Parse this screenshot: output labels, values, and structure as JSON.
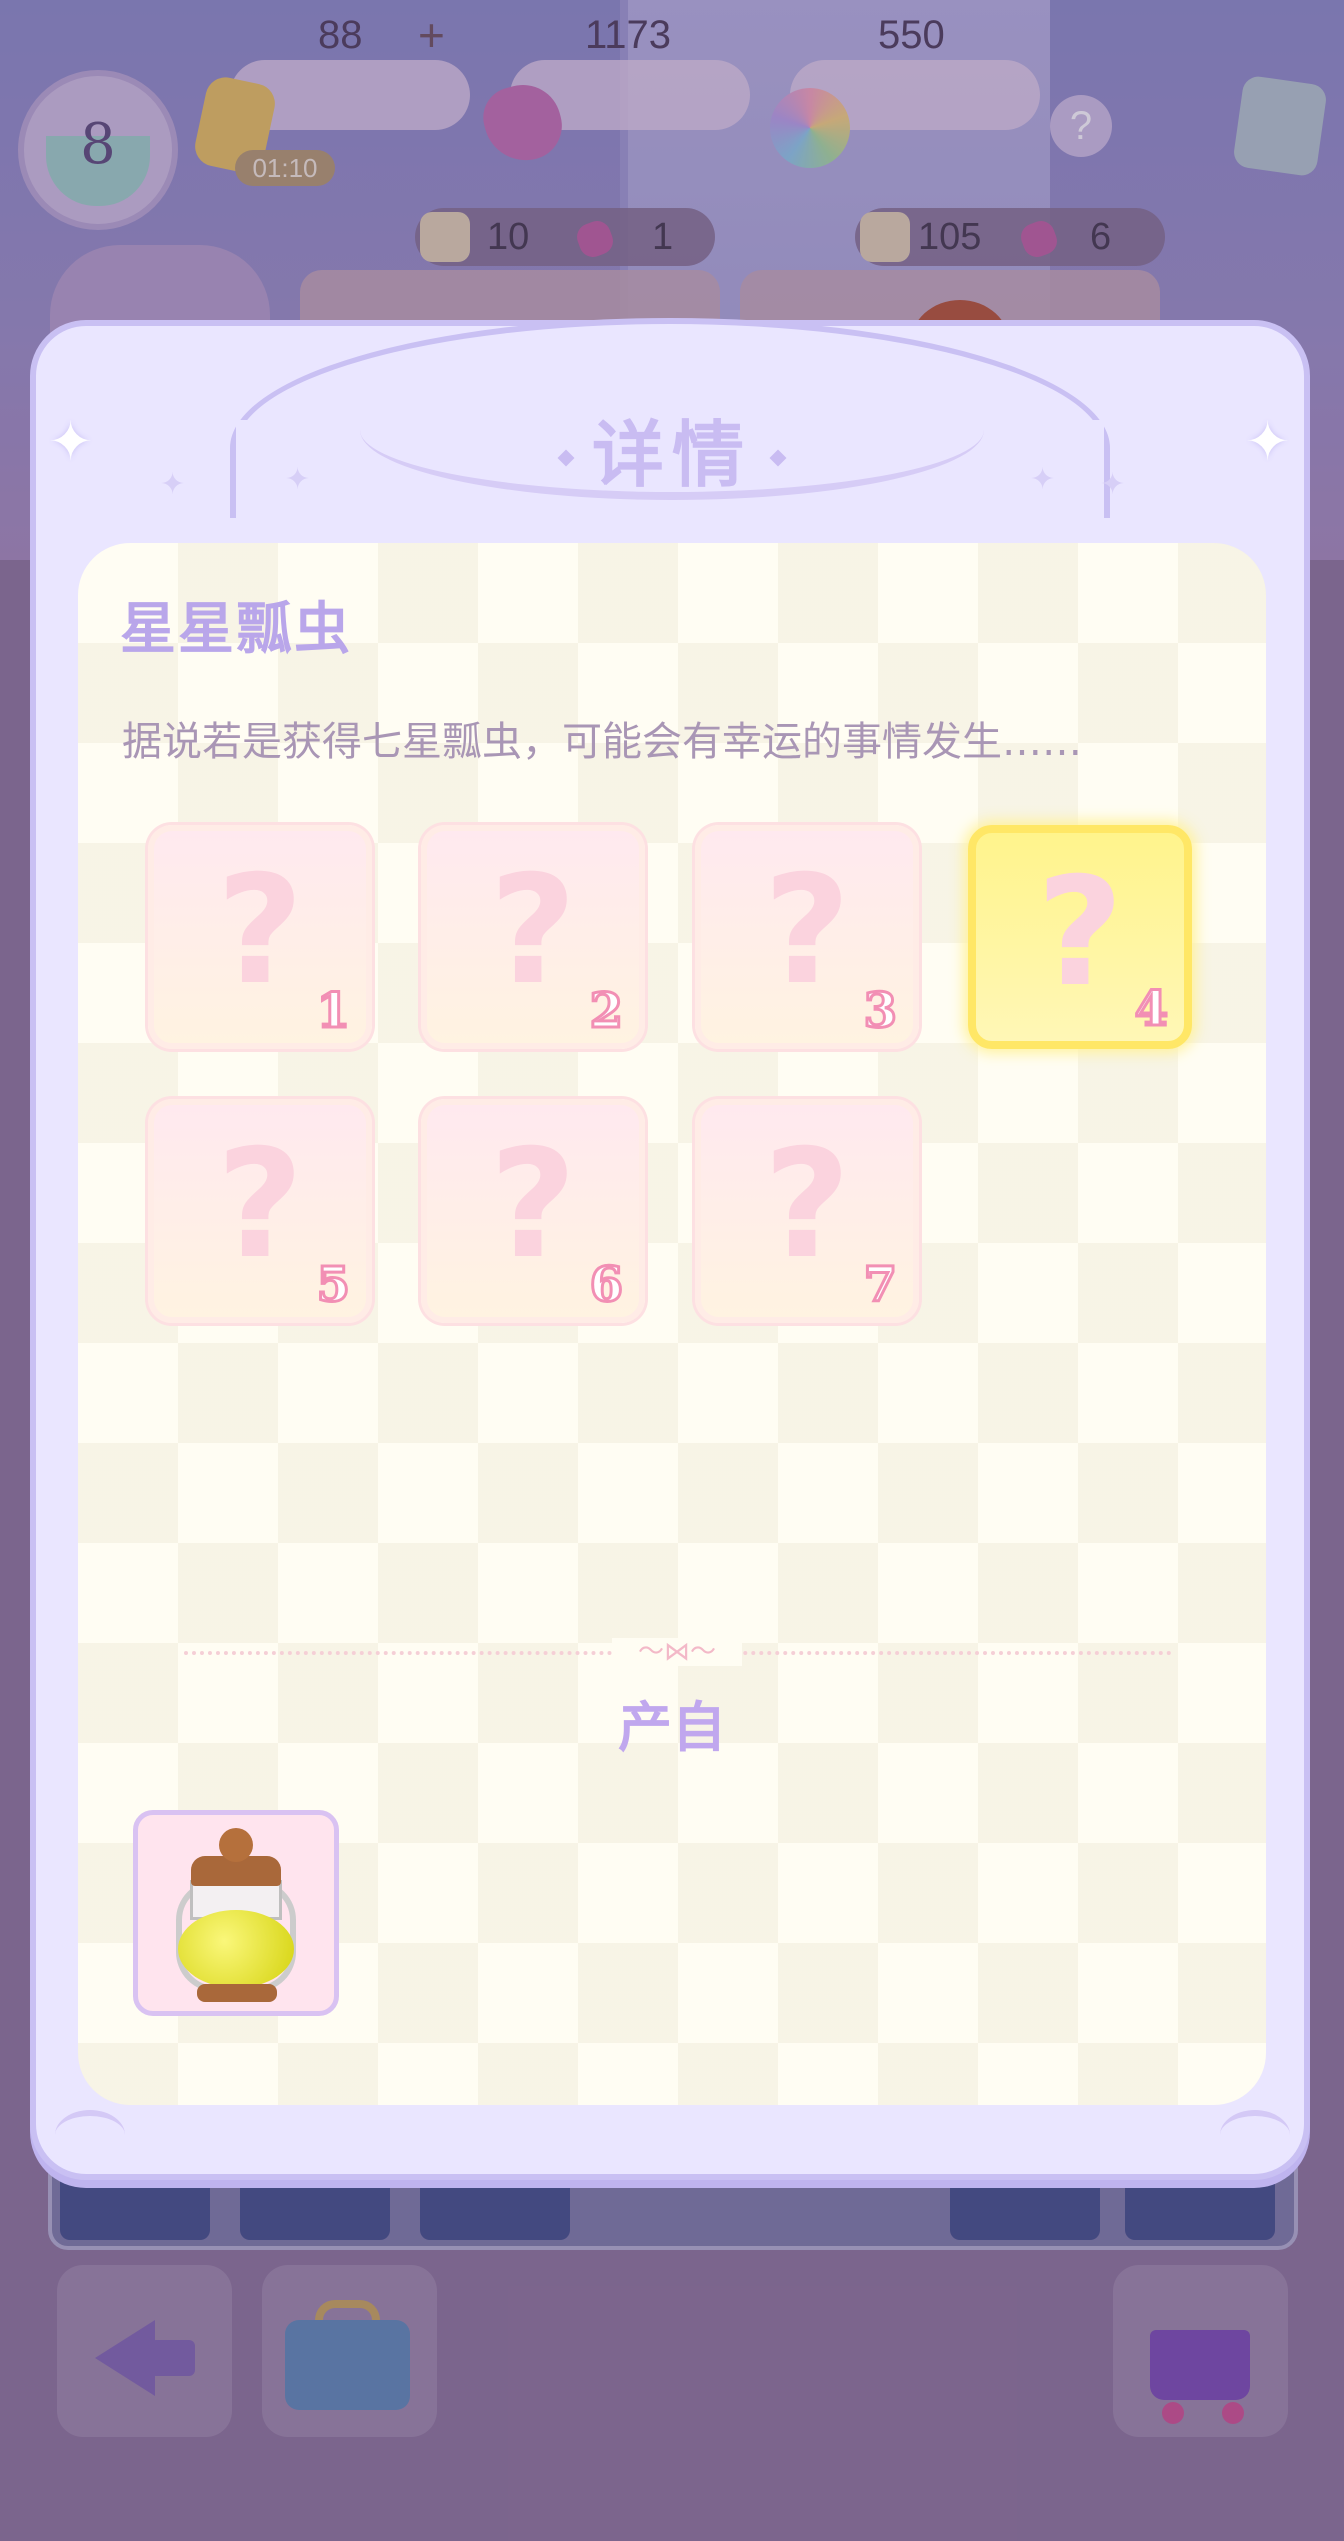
{
  "hud": {
    "level": "8",
    "energy": "88",
    "energy_plus": "+",
    "energy_timer": "01:10",
    "gems": "1173",
    "stars": "550",
    "help": "?"
  },
  "orders": [
    {
      "exp": "10",
      "gems": "1"
    },
    {
      "exp": "105",
      "gems": "6"
    }
  ],
  "modal": {
    "title": "详情",
    "item_name": "星星瓢虫",
    "description": "据说若是获得七星瓢虫，可能会有幸运的事情发生……",
    "slots": [
      {
        "label": "?",
        "number": "1",
        "highlighted": false
      },
      {
        "label": "?",
        "number": "2",
        "highlighted": false
      },
      {
        "label": "?",
        "number": "3",
        "highlighted": false
      },
      {
        "label": "?",
        "number": "4",
        "highlighted": true
      },
      {
        "label": "?",
        "number": "5",
        "highlighted": false
      },
      {
        "label": "?",
        "number": "6",
        "highlighted": false
      },
      {
        "label": "?",
        "number": "7",
        "highlighted": false
      }
    ],
    "source_title": "产自",
    "source_item_icon": "lantern-icon"
  },
  "colors": {
    "title": "#c9bcf2",
    "item_name": "#b9a6ea",
    "description": "#a996b5",
    "highlight_slot": "#fff48c",
    "slot_number_stroke": "#f28fb4"
  }
}
